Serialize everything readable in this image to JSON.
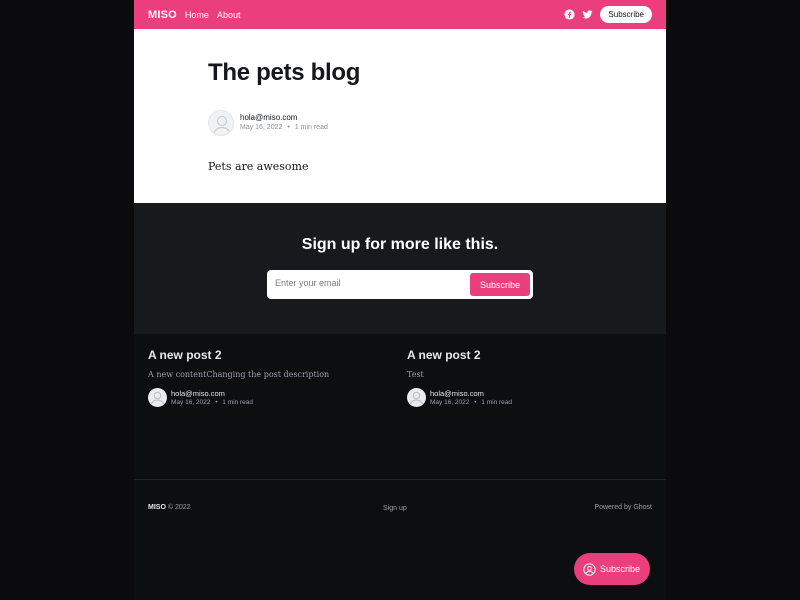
{
  "header": {
    "brand": "MISO",
    "nav": [
      "Home",
      "About"
    ],
    "social_icons": [
      "facebook-icon",
      "twitter-icon"
    ],
    "subscribe_label": "Subscribe",
    "accent": "#ea3f7c"
  },
  "post": {
    "title": "The pets blog",
    "author": "hola@miso.com",
    "date": "May 16, 2022",
    "read_time": "1 min read",
    "body": "Pets are awesome"
  },
  "cta": {
    "title": "Sign up for more like this.",
    "placeholder": "Enter your email",
    "button": "Subscribe"
  },
  "related": [
    {
      "title": "A new post 2",
      "excerpt": "A new contentChanging the post description",
      "author": "hola@miso.com",
      "date": "May 16, 2022",
      "read_time": "1 min read"
    },
    {
      "title": "A new post 2",
      "excerpt": "Test",
      "author": "hola@miso.com",
      "date": "May 16, 2022",
      "read_time": "1 min read"
    }
  ],
  "footer": {
    "brand": "MISO",
    "copyright": "© 2022",
    "signup": "Sign up",
    "powered": "Powered by Ghost"
  },
  "floating_subscribe": {
    "label": "Subscribe"
  },
  "meta_separator": "•"
}
